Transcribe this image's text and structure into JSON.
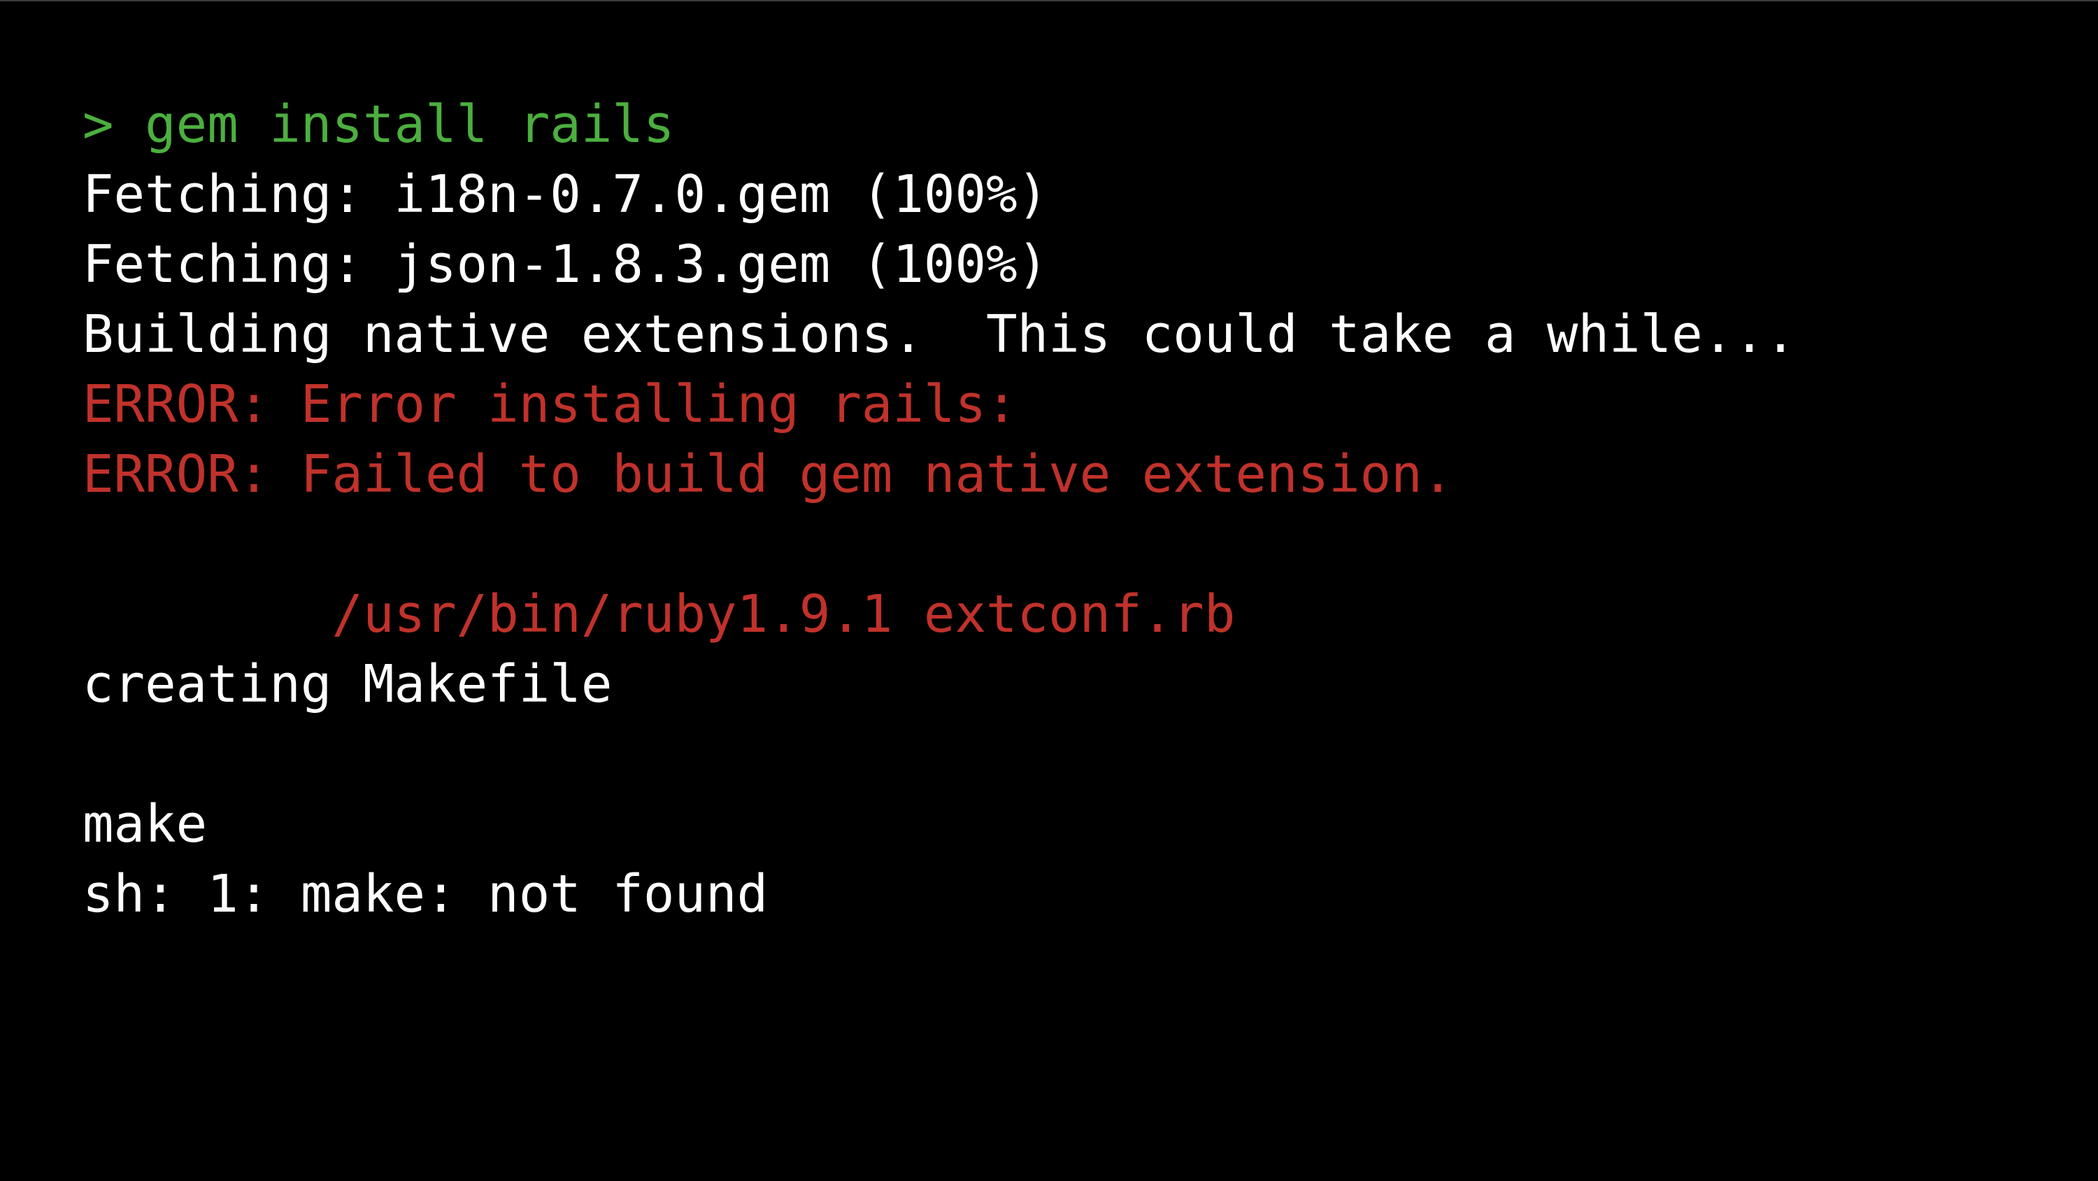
{
  "terminal": {
    "colors": {
      "background": "#000000",
      "prompt": "#4caf3f",
      "error": "#c0322b",
      "text": "#ffffff"
    },
    "lines": [
      {
        "kind": "prompt",
        "text": "> gem install rails"
      },
      {
        "kind": "plain",
        "text": "Fetching: i18n-0.7.0.gem (100%)"
      },
      {
        "kind": "plain",
        "text": "Fetching: json-1.8.3.gem (100%)"
      },
      {
        "kind": "plain",
        "text": "Building native extensions.  This could take a while..."
      },
      {
        "kind": "err",
        "text": "ERROR: Error installing rails:"
      },
      {
        "kind": "err",
        "text": "ERROR: Failed to build gem native extension."
      },
      {
        "kind": "blank",
        "text": ""
      },
      {
        "kind": "err",
        "text": "        /usr/bin/ruby1.9.1 extconf.rb"
      },
      {
        "kind": "plain",
        "text": "creating Makefile"
      },
      {
        "kind": "blank",
        "text": ""
      },
      {
        "kind": "plain",
        "text": "make"
      },
      {
        "kind": "plain",
        "text": "sh: 1: make: not found"
      }
    ]
  }
}
